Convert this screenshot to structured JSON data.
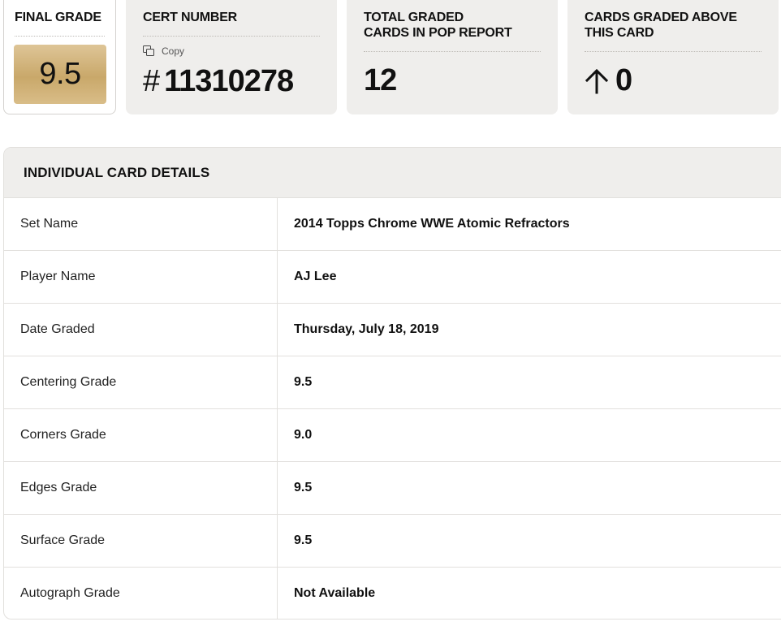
{
  "final_grade": {
    "label": "FINAL GRADE",
    "value": "9.5"
  },
  "cert_number": {
    "label": "CERT NUMBER",
    "copy_label": "Copy",
    "hash": "#",
    "value": "11310278"
  },
  "pop_report": {
    "label": "TOTAL GRADED\nCARDS IN POP REPORT",
    "value": "12"
  },
  "graded_above": {
    "label": "CARDS GRADED ABOVE\nTHIS CARD",
    "arrow_icon": "arrow-up-icon",
    "value": "0"
  },
  "details": {
    "title": "INDIVIDUAL CARD DETAILS",
    "rows": [
      {
        "label": "Set Name",
        "value": "2014 Topps Chrome WWE Atomic Refractors"
      },
      {
        "label": "Player Name",
        "value": "AJ Lee"
      },
      {
        "label": "Date Graded",
        "value": "Thursday, July 18, 2019"
      },
      {
        "label": "Centering Grade",
        "value": "9.5"
      },
      {
        "label": "Corners Grade",
        "value": "9.0"
      },
      {
        "label": "Edges Grade",
        "value": "9.5"
      },
      {
        "label": "Surface Grade",
        "value": "9.5"
      },
      {
        "label": "Autograph Grade",
        "value": "Not Available"
      }
    ]
  },
  "colors": {
    "card_bg": "#efeeec",
    "gold_grade": "#d2b47d",
    "border": "#e2e0dd",
    "text": "#111111"
  }
}
